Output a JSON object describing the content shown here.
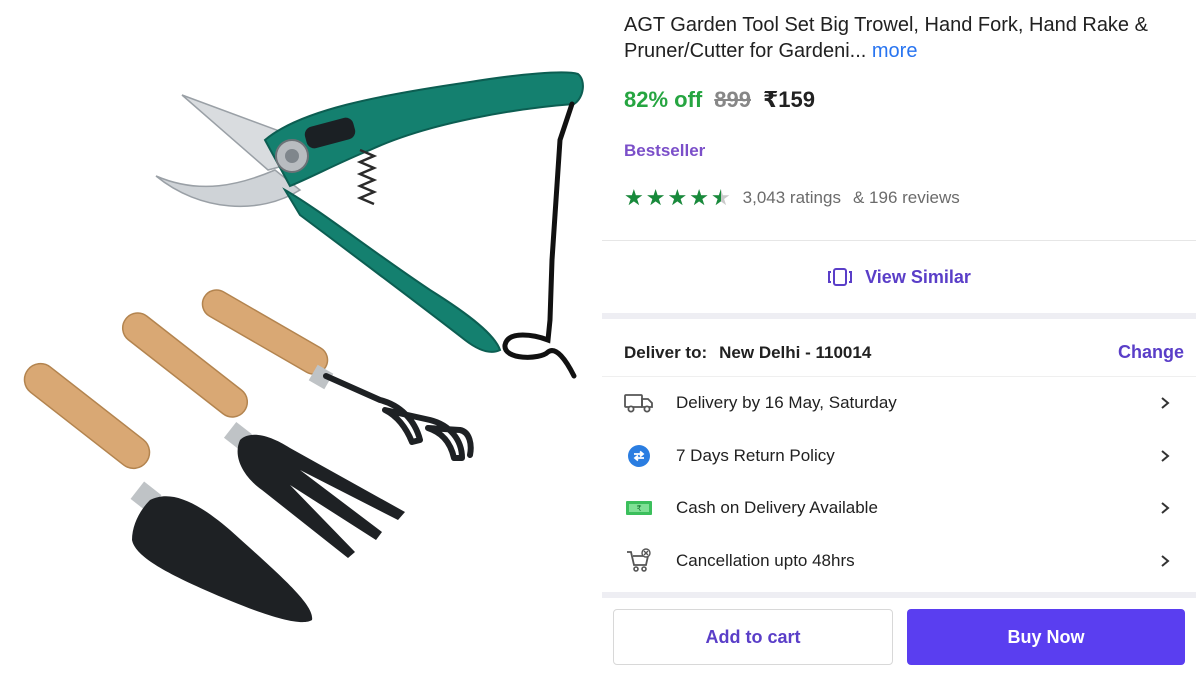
{
  "product": {
    "title": "AGT Garden Tool Set Big Trowel, Hand Fork, Hand Rake & Pruner/Cutter for Gardeni...",
    "more_label": "more"
  },
  "pricing": {
    "discount": "82% off",
    "mrp": "899",
    "price": "₹159"
  },
  "badge": "Bestseller",
  "rating": {
    "stars": 4.5,
    "ratings_text": "3,043 ratings",
    "reviews_text": "& 196 reviews",
    "star_color": "#188a3b"
  },
  "view_similar": {
    "label": "View Similar",
    "icon": "view-similar-icon"
  },
  "delivery": {
    "label": "Deliver to:",
    "location": "New Delhi - 110014",
    "change_label": "Change"
  },
  "services": [
    {
      "icon": "truck-icon",
      "label": "Delivery by 16 May, Saturday"
    },
    {
      "icon": "return-icon",
      "label": "7 Days Return Policy"
    },
    {
      "icon": "cash-icon",
      "label": "Cash on Delivery Available"
    },
    {
      "icon": "cart-cancel-icon",
      "label": "Cancellation upto 48hrs"
    }
  ],
  "actions": {
    "add_to_cart": "Add to cart",
    "buy_now": "Buy Now"
  },
  "colors": {
    "accent": "#5a3ec8",
    "buy_button": "#5a3ef0",
    "discount": "#26a541",
    "badge": "#7b4fc9"
  }
}
